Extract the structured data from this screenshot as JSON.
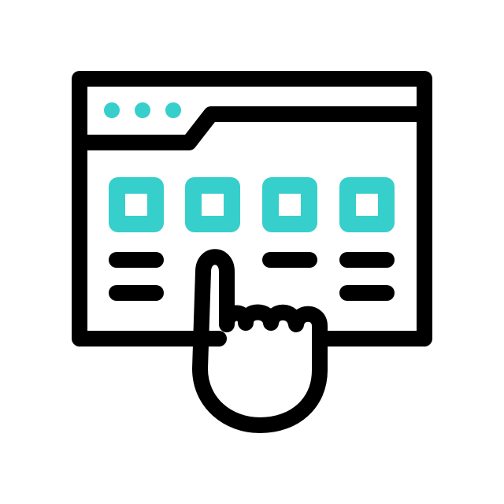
{
  "icon": {
    "name": "browser-window-click-icon",
    "colors": {
      "stroke": "#000000",
      "accent": "#37cfcb",
      "background": "#ffffff"
    },
    "window": {
      "control_dots": 3,
      "tiles": 4,
      "text_line_rows": 2,
      "text_line_columns": 3
    },
    "pointer": "hand-pointer-icon"
  }
}
